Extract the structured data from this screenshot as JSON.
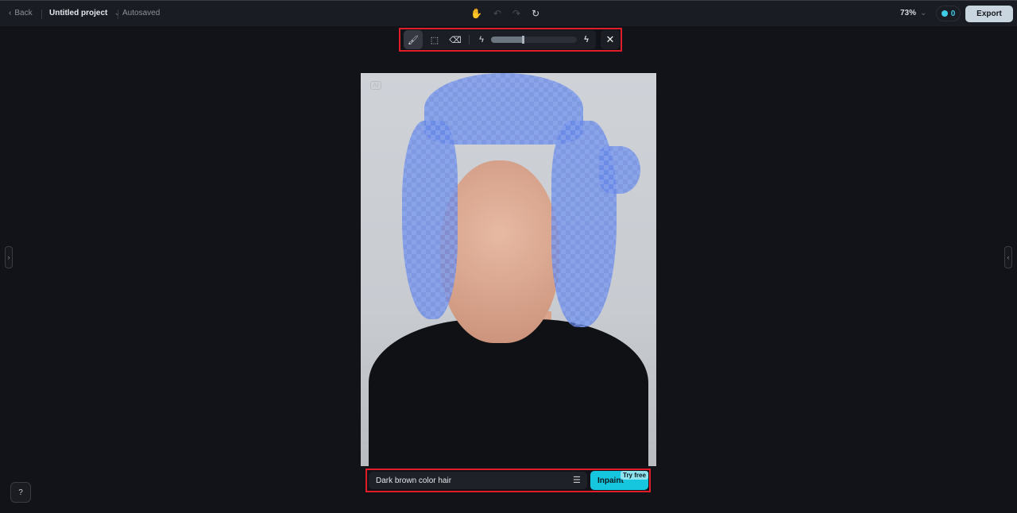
{
  "header": {
    "back_label": "Back",
    "project_title": "Untitled project",
    "save_status": "Autosaved",
    "zoom_level": "73%",
    "credits": "0",
    "export_label": "Export"
  },
  "history_tools": [
    {
      "icon": "hand-icon"
    },
    {
      "icon": "undo-icon",
      "enabled": false
    },
    {
      "icon": "redo-icon",
      "enabled": false
    },
    {
      "icon": "refresh-icon"
    }
  ],
  "brush_toolbar": {
    "tools": [
      {
        "icon": "brush-icon",
        "active": true
      },
      {
        "icon": "select-icon"
      },
      {
        "icon": "eraser-icon"
      }
    ],
    "brush_size_percent": 37,
    "min_icon": "small-brush-icon",
    "max_icon": "large-brush-icon",
    "close_icon": "close-icon"
  },
  "canvas": {
    "badge": "AI",
    "mask_color": "#6284e6"
  },
  "prompt": {
    "value": "Dark brown color hair",
    "action_label": "Inpaint",
    "badge": "Try free",
    "accent": "#16c6de"
  },
  "colors": {
    "background": "#121318",
    "highlight": "#e11d2a"
  }
}
